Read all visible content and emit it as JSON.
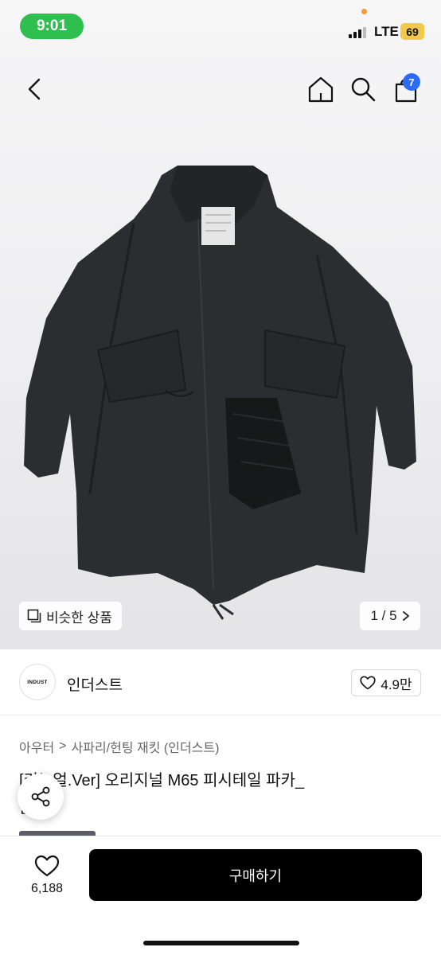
{
  "status_bar": {
    "time": "9:01",
    "network": "LTE",
    "battery": "69"
  },
  "nav": {
    "cart_count": "7"
  },
  "gallery": {
    "similar_label": "비슷한 상품",
    "page_indicator": "1 / 5"
  },
  "brand": {
    "logo_text": "INDUST",
    "name": "인더스트",
    "likes": "4.9만"
  },
  "breadcrumb": {
    "level1": "아우터",
    "separator": ">",
    "level2": "사파리/헌팅 재킷 (인더스트)"
  },
  "product": {
    "title_line1": "[리뉴얼.Ver] 오리지널 M65 피시테일 파카_",
    "title_line2": "블랙"
  },
  "bottom_bar": {
    "wish_count": "6,188",
    "buy_label": "구매하기"
  },
  "colors": {
    "status_green": "#2fbf4e",
    "badge_blue": "#2b6cf6",
    "battery_yellow": "#f2c94c",
    "buy_black": "#000000"
  },
  "icons": [
    "back-icon",
    "home-icon",
    "search-icon",
    "shopping-bag-icon",
    "similar-icon",
    "chevron-right-icon",
    "heart-icon",
    "share-icon"
  ]
}
